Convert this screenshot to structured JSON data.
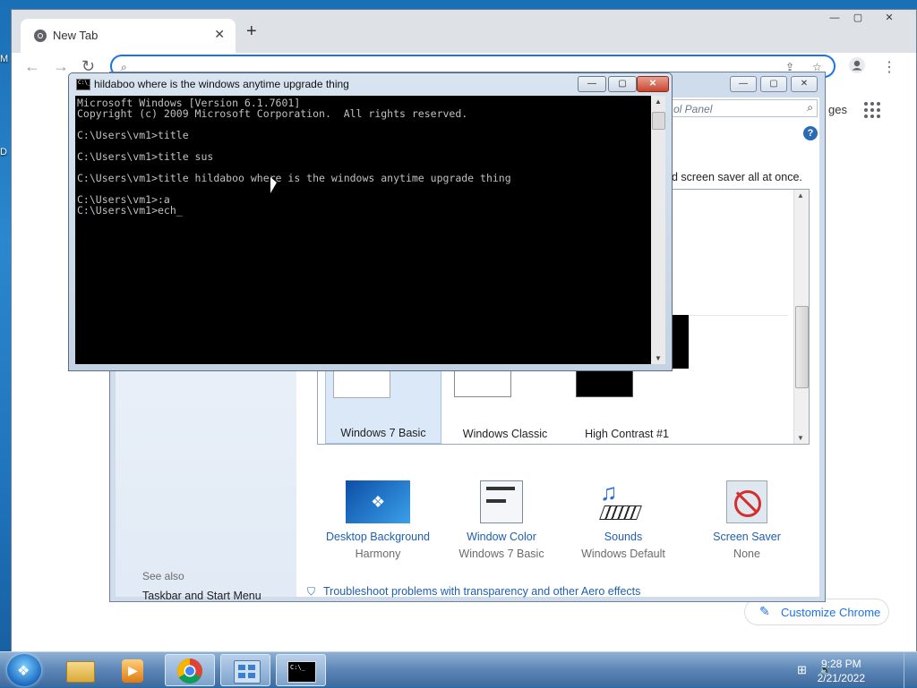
{
  "desktop": {
    "left_label_1": "M",
    "left_label_2": "D"
  },
  "chrome": {
    "tab_title": "New Tab",
    "tab_close": "✕",
    "new_tab": "+",
    "min": "—",
    "max": "▢",
    "close": "✕",
    "partial_text": "ges",
    "customize_label": "Customize Chrome",
    "colors": {
      "omnibox_border": "#1a73e8"
    }
  },
  "personalization": {
    "search_placeholder": "ol Panel",
    "description": "nd screen saver all at once.",
    "help": "?",
    "themes": [
      {
        "label": "Windows 7 Basic",
        "selected": true
      },
      {
        "label": "Windows Classic",
        "selected": false
      },
      {
        "label": "High Contrast #1",
        "selected": false
      }
    ],
    "bottom": [
      {
        "title": "Desktop Background",
        "sub": "Harmony"
      },
      {
        "title": "Window Color",
        "sub": "Windows 7 Basic"
      },
      {
        "title": "Sounds",
        "sub": "Windows Default"
      },
      {
        "title": "Screen Saver",
        "sub": "None"
      }
    ],
    "see_also": "See also",
    "taskbar_link": "Taskbar and Start Menu",
    "troubleshoot": "Troubleshoot problems with transparency and other Aero effects"
  },
  "cmd": {
    "title": "hildaboo where is the windows anytime upgrade thing",
    "icon_text": "C:\\_",
    "lines": [
      "Microsoft Windows [Version 6.1.7601]",
      "Copyright (c) 2009 Microsoft Corporation.  All rights reserved.",
      "",
      "C:\\Users\\vm1>title",
      "",
      "C:\\Users\\vm1>title sus",
      "",
      "C:\\Users\\vm1>title hildaboo where is the windows anytime upgrade thing",
      "",
      "C:\\Users\\vm1>:a",
      "C:\\Users\\vm1>ech_"
    ]
  },
  "taskbar": {
    "time": "9:28 PM",
    "date": "2/21/2022"
  }
}
